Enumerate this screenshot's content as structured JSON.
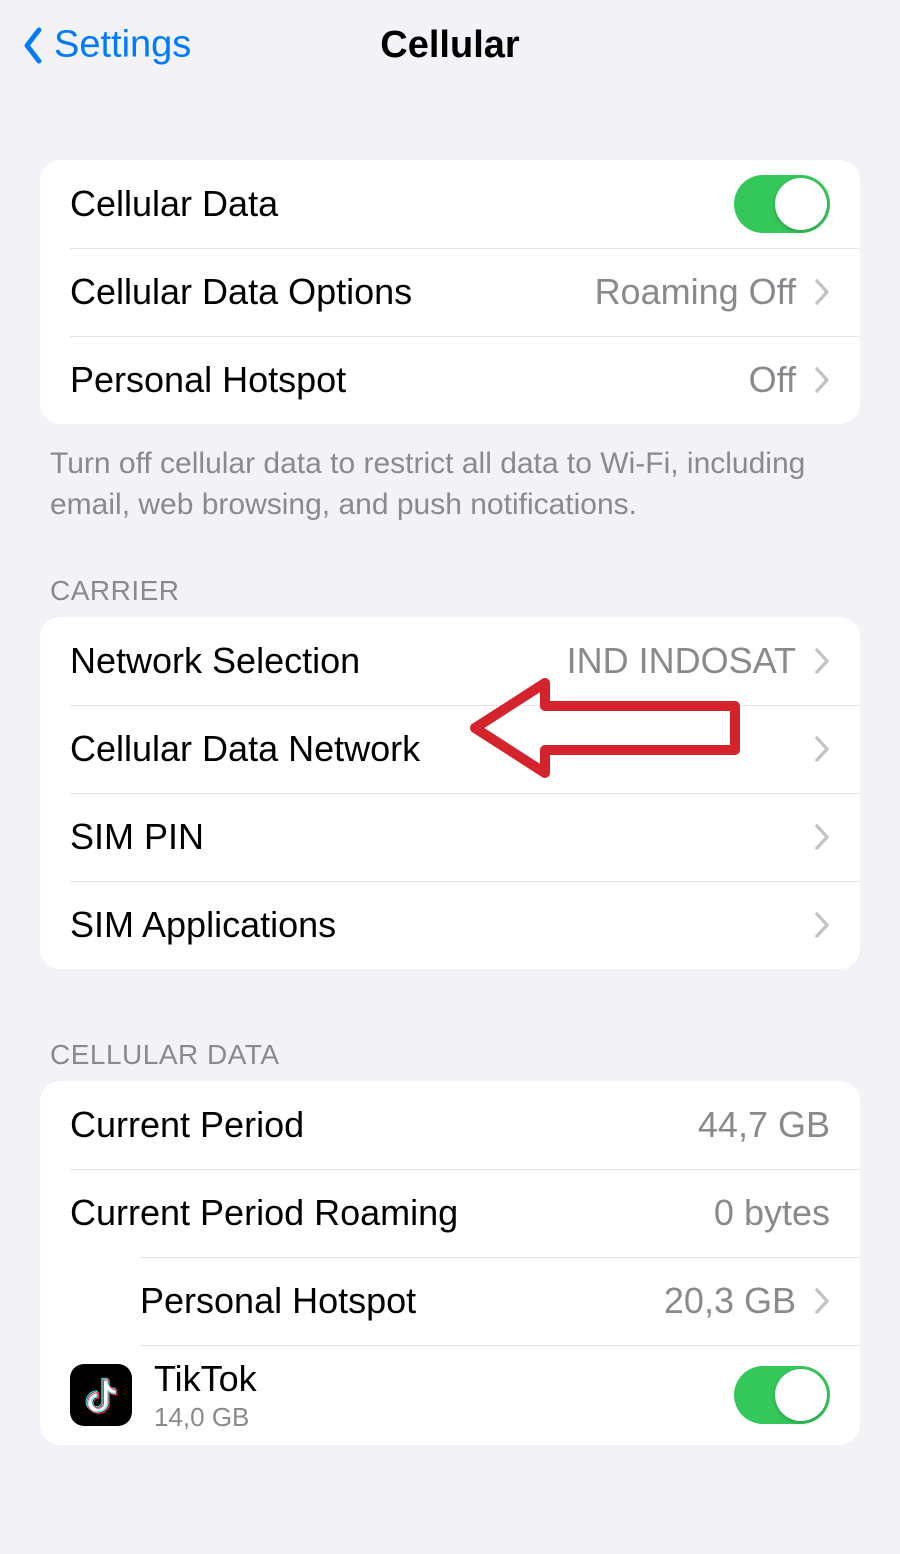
{
  "header": {
    "back_label": "Settings",
    "title": "Cellular"
  },
  "section1": {
    "cellular_data": {
      "label": "Cellular Data",
      "on": true
    },
    "options": {
      "label": "Cellular Data Options",
      "value": "Roaming Off"
    },
    "hotspot": {
      "label": "Personal Hotspot",
      "value": "Off"
    },
    "footer": "Turn off cellular data to restrict all data to Wi-Fi, including email, web browsing, and push notifications."
  },
  "carrier": {
    "header": "CARRIER",
    "network_selection": {
      "label": "Network Selection",
      "value": "IND INDOSAT"
    },
    "cellular_data_network": {
      "label": "Cellular Data Network"
    },
    "sim_pin": {
      "label": "SIM PIN"
    },
    "sim_applications": {
      "label": "SIM Applications"
    }
  },
  "cellular_data_section": {
    "header": "CELLULAR DATA",
    "current_period": {
      "label": "Current Period",
      "value": "44,7 GB"
    },
    "current_period_roaming": {
      "label": "Current Period Roaming",
      "value": "0 bytes"
    },
    "personal_hotspot": {
      "label": "Personal Hotspot",
      "value": "20,3 GB"
    },
    "tiktok": {
      "label": "TikTok",
      "sub": "14,0 GB",
      "on": true
    }
  },
  "annotation": {
    "type": "arrow",
    "color": "#d4232d",
    "points_to": "cellular_data_network"
  }
}
